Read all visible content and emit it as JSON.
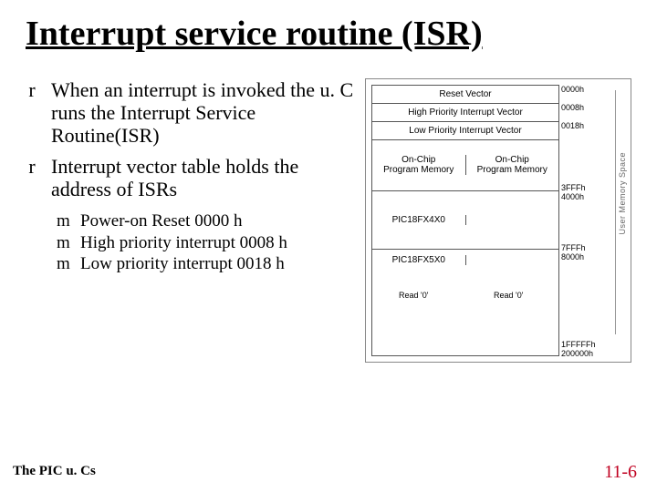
{
  "title": "Interrupt service routine (ISR)",
  "bullets": {
    "items": [
      "When an interrupt is invoked the u. C runs the Interrupt Service Routine(ISR)",
      "Interrupt vector table holds the address of ISRs"
    ],
    "sub": [
      "Power-on Reset 0000 h",
      "High priority interrupt 0008 h",
      "Low priority interrupt 0018 h"
    ]
  },
  "diagram": {
    "rows": {
      "reset": "Reset Vector",
      "hp": "High Priority Interrupt Vector",
      "lp": "Low Priority Interrupt Vector",
      "onchipL": "On-Chip\nProgram Memory",
      "onchipR": "On-Chip\nProgram Memory",
      "pic4": "PIC18FX4X0",
      "pic5": "PIC18FX5X0",
      "readL": "Read '0'",
      "readR": "Read '0'"
    },
    "addrs": {
      "a0": "0000h",
      "a1": "0008h",
      "a2": "0018h",
      "a3a": "3FFFh",
      "a3b": "4000h",
      "a4a": "7FFFh",
      "a4b": "8000h",
      "a5a": "1FFFFFh",
      "a5b": "200000h"
    },
    "side": "User Memory Space"
  },
  "footer": {
    "left": "The PIC u. Cs",
    "right": "11-6"
  }
}
